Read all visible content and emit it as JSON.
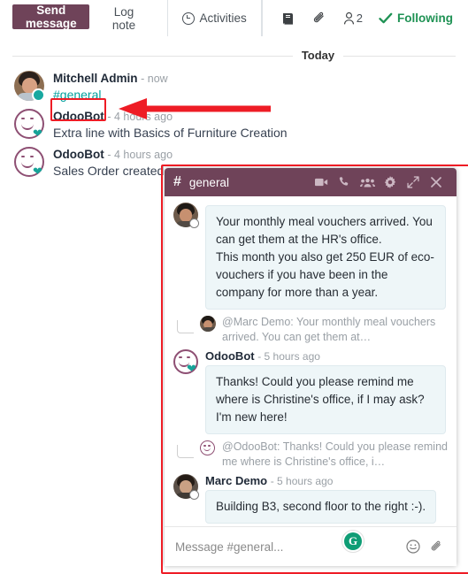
{
  "topbar": {
    "send_message_label": "Send message",
    "log_note_label": "Log note",
    "activities_label": "Activities",
    "followers_count": "2",
    "following_label": "Following",
    "icons": {
      "log_icon": "book-icon",
      "attachment_icon": "paperclip-icon",
      "followers_icon": "user-icon",
      "following_check_icon": "check-icon",
      "activities_icon": "clock-icon"
    },
    "colors": {
      "primary": "#6f4359",
      "following_green": "#1f9254"
    }
  },
  "thread": {
    "day_separator": "Today",
    "messages": [
      {
        "author": "Mitchell Admin",
        "time": "- now",
        "body": "#general",
        "is_link": true,
        "avatar": "mitchell-admin-avatar",
        "status": "online"
      },
      {
        "author": "OdooBot",
        "time": "- 4 hours ago",
        "body": "Extra line with Basics of Furniture Creation",
        "is_link": false,
        "avatar": "odoobot-avatar",
        "status": "bot"
      },
      {
        "author": "OdooBot",
        "time": "- 4 hours ago",
        "body": "Sales Order created",
        "is_link": false,
        "avatar": "odoobot-avatar",
        "status": "bot"
      }
    ]
  },
  "chat_window": {
    "hash": "#",
    "title": "general",
    "header_icons": [
      {
        "name": "video-camera-icon",
        "glyph": "video"
      },
      {
        "name": "phone-icon",
        "glyph": "phone"
      },
      {
        "name": "members-icon",
        "glyph": "people"
      },
      {
        "name": "settings-gear-icon",
        "glyph": "gear"
      },
      {
        "name": "expand-icon",
        "glyph": "expand"
      },
      {
        "name": "close-icon",
        "glyph": "x"
      }
    ],
    "messages": [
      {
        "type": "bubble",
        "author": "",
        "time": "",
        "avatar": "marc-demo-avatar",
        "text": "Your monthly meal vouchers arrived. You can get them at the HR's office.\nThis month you also get 250 EUR of eco-vouchers if you have been in the company for more than a year."
      },
      {
        "type": "quote",
        "mention": "@Marc Demo:",
        "avatar": "marc-demo-avatar",
        "text": "Your monthly meal vouchers arrived. You can get them at…"
      },
      {
        "type": "bubble",
        "author": "OdooBot",
        "time": "- 5 hours ago",
        "avatar": "odoobot-avatar",
        "text": "Thanks! Could you please remind me where is Christine's office, if I may ask? I'm new here!"
      },
      {
        "type": "quote",
        "mention": "@OdooBot:",
        "avatar": "odoobot-avatar",
        "text": "Thanks! Could you please remind me where is Christine's office, i…"
      },
      {
        "type": "bubble",
        "author": "Marc Demo",
        "time": "- 5 hours ago",
        "avatar": "marc-demo-avatar",
        "text": "Building B3, second floor to the right :-)."
      }
    ],
    "composer": {
      "placeholder": "Message #general...",
      "grammarly_letter": "G",
      "emoji_icon": "smiley-icon",
      "attachment_icon": "paperclip-icon"
    },
    "colors": {
      "header": "#6f4359",
      "bubble": "#eef6f8",
      "grammarly": "#0f9d75"
    }
  },
  "annotations": {
    "highlight_color": "#ee1c25",
    "highlight_general_link": "#general",
    "highlight_chat_window": "general chat window"
  }
}
